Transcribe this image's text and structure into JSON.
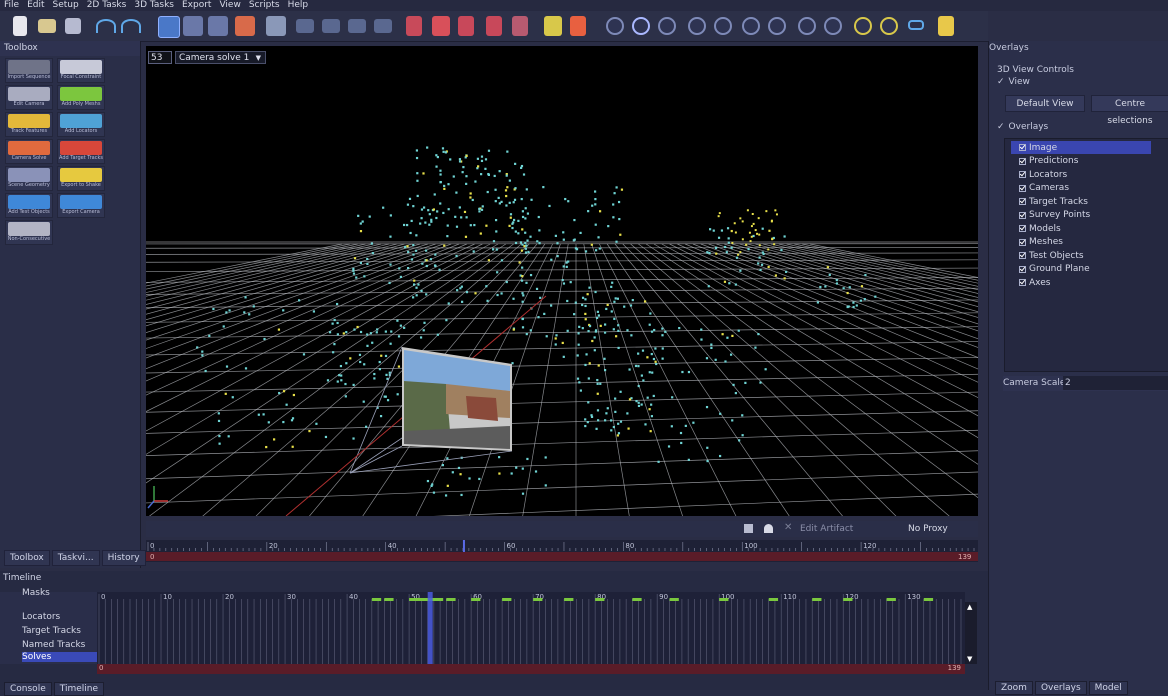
{
  "menu": [
    "File",
    "Edit",
    "Setup",
    "2D Tasks",
    "3D Tasks",
    "Export",
    "View",
    "Scripts",
    "Help"
  ],
  "toolbox": {
    "title": "Toolbox",
    "tools": [
      {
        "label": "Import Sequence",
        "color": "#6f7388"
      },
      {
        "label": "Focal Constraint",
        "color": "#c7c9d8"
      },
      {
        "label": "Edit Camera",
        "color": "#a9acc0"
      },
      {
        "label": "Add Poly Meshs",
        "color": "#7cc63e"
      },
      {
        "label": "Track Features",
        "color": "#e3b83a"
      },
      {
        "label": "Add Locators",
        "color": "#4fa2d6"
      },
      {
        "label": "Camera Solve",
        "color": "#e06a3e"
      },
      {
        "label": "Add Target Tracks",
        "color": "#d8473a"
      },
      {
        "label": "Scene Geometry",
        "color": "#8a92b8"
      },
      {
        "label": "Export to Shake",
        "color": "#e6c93f"
      },
      {
        "label": "Add Test Objects",
        "color": "#3f88d8"
      },
      {
        "label": "Export Camera",
        "color": "#3f88d8"
      },
      {
        "label": "Non-Consecutive",
        "color": "#b2b4c4"
      }
    ],
    "tabs": [
      "Toolbox",
      "Taskvi...",
      "History"
    ]
  },
  "viewport": {
    "frame": "53",
    "camera_select": "Camera solve 1",
    "scene": "3D point cloud of camera-solve feature tracks over ground-plane grid with camera frustum showing current frame image"
  },
  "viewbar": {
    "edit_artifact": "Edit Artifact",
    "proxy": "No Proxy"
  },
  "scrubber": {
    "ticks": [
      "0",
      "20",
      "40",
      "60",
      "80",
      "100",
      "120"
    ],
    "start": "0",
    "end": "139"
  },
  "overlays_panel": {
    "title": "Overlays",
    "controls_heading": "3D View Controls",
    "view_toggle": "View",
    "default_view": "Default View",
    "centre_selections": "Centre selections",
    "overlays_toggle": "Overlays",
    "items": [
      "Image",
      "Predictions",
      "Locators",
      "Cameras",
      "Target Tracks",
      "Survey Points",
      "Models",
      "Meshes",
      "Test Objects",
      "Ground Plane",
      "Axes"
    ],
    "selected": "Image",
    "camera_scale_label": "Camera Scale",
    "camera_scale_value": "2",
    "tabs": [
      "Zoom",
      "Overlays",
      "Model"
    ]
  },
  "timeline": {
    "title": "Timeline",
    "tracks": [
      "Masks",
      "Locators",
      "Target Tracks",
      "Named Tracks",
      "Solves"
    ],
    "ticks": [
      "0",
      "10",
      "20",
      "30",
      "40",
      "50",
      "60",
      "70",
      "80",
      "90",
      "100",
      "110",
      "120",
      "130"
    ],
    "start": "0",
    "end": "139",
    "tabs": [
      "Console",
      "Timeline"
    ]
  },
  "colors": {
    "points": "#6fd4d4",
    "points_alt": "#e8e04a",
    "grid": "#bfc2c8"
  }
}
